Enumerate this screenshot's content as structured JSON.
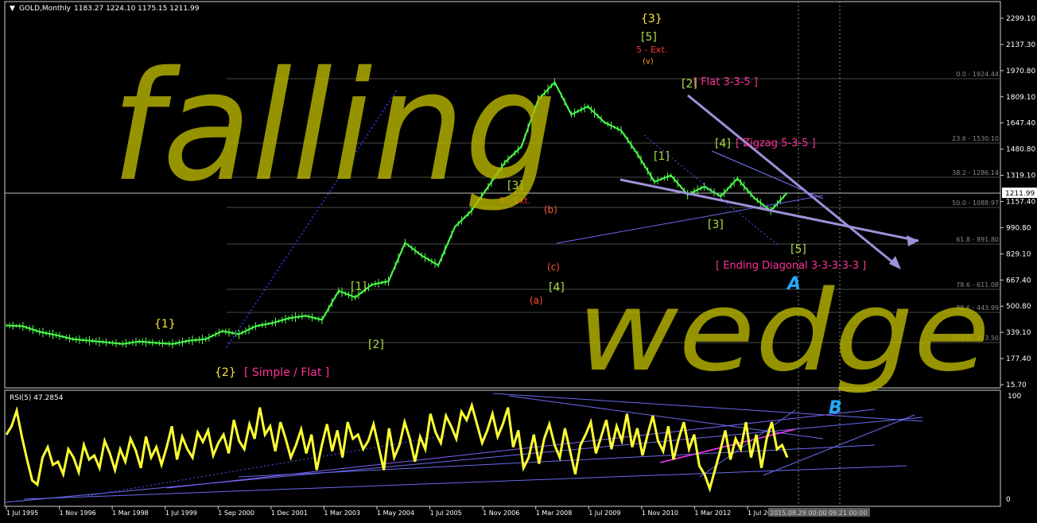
{
  "window": {
    "symbol_title": "GOLD,Monthly",
    "ohlc": "1183.27 1224.10 1175.15 1211.99"
  },
  "rsi": {
    "title": "RSI(5) 47.2854",
    "max_label": "100",
    "min_label": "0",
    "values": [
      62,
      70,
      85,
      60,
      38,
      18,
      14,
      40,
      50,
      33,
      36,
      24,
      48,
      40,
      26,
      52,
      38,
      42,
      30,
      56,
      44,
      28,
      48,
      36,
      58,
      47,
      30,
      60,
      40,
      50,
      33,
      50,
      70,
      38,
      60,
      48,
      40,
      64,
      55,
      66,
      42,
      54,
      62,
      44,
      76,
      56,
      48,
      72,
      58,
      88,
      62,
      70,
      46,
      74,
      58,
      40,
      52,
      67,
      44,
      62,
      28,
      52,
      72,
      46,
      66,
      40,
      74,
      58,
      62,
      48,
      56,
      72,
      50,
      28,
      68,
      40,
      52,
      74,
      58,
      36,
      60,
      48,
      82,
      64,
      54,
      80,
      70,
      58,
      84,
      76,
      90,
      72,
      54,
      66,
      82,
      60,
      72,
      88,
      50,
      66,
      30,
      40,
      62,
      34,
      58,
      72,
      52,
      40,
      68,
      46,
      24,
      52,
      62,
      74,
      44,
      60,
      76,
      48,
      70,
      56,
      82,
      50,
      68,
      42,
      62,
      80,
      56,
      46,
      70,
      38,
      58,
      74,
      48,
      62,
      32,
      24,
      10,
      28,
      46,
      66,
      38,
      58,
      48,
      74,
      40,
      62,
      30,
      58,
      74,
      48,
      52,
      40
    ]
  },
  "price_axis": {
    "ticks": [
      "2299.10",
      "2137.30",
      "1970.80",
      "1809.10",
      "1647.40",
      "1480.80",
      "1319.10",
      "1157.40",
      "990.80",
      "829.10",
      "667.40",
      "500.80",
      "339.10",
      "177.40",
      "15.70"
    ],
    "current_price": "1211.99"
  },
  "fib_levels": [
    {
      "label": "0.0 - 1924.44"
    },
    {
      "label": "23.6 - 1530.10"
    },
    {
      "label": "38.2 - 1286.14"
    },
    {
      "label": "50.0 - 1088.97"
    },
    {
      "label": "61.8 - 891.80"
    },
    {
      "label": "78.6 - 611.08"
    },
    {
      "label": "88.6 - 443.99"
    },
    {
      "label": "100.0 - 253.50"
    }
  ],
  "time_axis": {
    "labels": [
      "1 Jul 1995",
      "1 Nov 1996",
      "1 Mar 1998",
      "1 Jul 1999",
      "1 Sep 2000",
      "1 Dec 2001",
      "1 Mar 2003",
      "1 May 2004",
      "1 Jul 2005",
      "1 Nov 2006",
      "1 Mar 2008",
      "1 Jul 2009",
      "1 Nov 2010",
      "1 Mar 2012",
      "1 Jul 2013"
    ],
    "highlight": "2015.08.29 00:00 09.21 00:00"
  },
  "handwriting": {
    "word1": "falling",
    "word2": "wedge",
    "mark_a": "A",
    "mark_b": "B"
  },
  "wave_labels": {
    "w1_curly": "{1}",
    "w2_curly": "{2}",
    "w3_curly": "{3}",
    "simple_flat": "[ Simple / Flat ]",
    "flat_335": "[ Flat 3-3-5 ]",
    "zigzag": "[ Zigzag 5-3-5 ]",
    "ending_diag": "[ Ending Diagonal 3-3-3-3-3 ]",
    "ext5_top": "5 - Ext.",
    "ext5_mid": "5 - Ext.",
    "sq1a": "[1]",
    "sq2a": "[2]",
    "sq3a": "[3]",
    "sq4a": "[4]",
    "sq5a": "[5]",
    "sq1b": "[1]",
    "sq2b": "[2]",
    "sq3b": "[3]",
    "sq4b": "[4]",
    "sq5b": "[5]",
    "par_a": "(a)",
    "par_b": "(b)",
    "par_c": "(c)",
    "par_v": "(v)"
  },
  "chart_data": {
    "type": "line",
    "title": "GOLD,Monthly",
    "x_range": [
      "1 Jul 1995",
      "2015.09"
    ],
    "ylim": [
      15.7,
      2299.1
    ],
    "series": [
      {
        "values": [
          385,
          380,
          345,
          325,
          300,
          290,
          280,
          270,
          285,
          276,
          270,
          290,
          300,
          350,
          330,
          380,
          400,
          430,
          445,
          420,
          600,
          560,
          640,
          660,
          900,
          820,
          760,
          1000,
          1100,
          1250,
          1400,
          1500,
          1790,
          1900,
          1700,
          1750,
          1650,
          1600,
          1450,
          1280,
          1320,
          1200,
          1250,
          1190,
          1300,
          1180,
          1100,
          1211.99
        ]
      }
    ],
    "rsi": {
      "name": "RSI(5)",
      "ylim": [
        0,
        100
      ],
      "last": 47.2854
    }
  }
}
